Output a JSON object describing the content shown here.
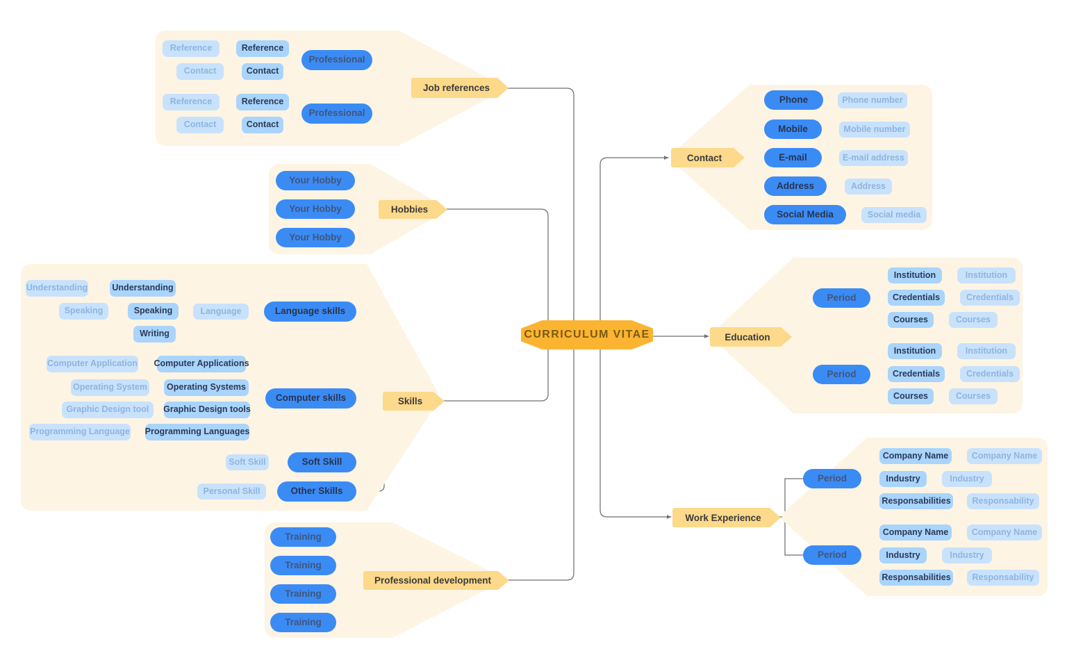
{
  "core": {
    "label": "CURRICULUM VITAE"
  },
  "palette": {
    "canvas": "#ffffff",
    "backdrop": "#fdf4e3",
    "core_fill": "#fbb431",
    "core_text": "#7a5a12",
    "chip_fill": "#fcd98b",
    "chip_text": "#3a3a3a",
    "blue": "#3b8bf5",
    "blue_text": "#41557a",
    "mid_blue": "#a9d4fb",
    "mid_blue_text": "#2c3a57",
    "pale_blue": "#c8e2fc",
    "pale_blue_text": "#8fb4de",
    "wire": "#6f6f6f"
  },
  "branches": {
    "job_references": {
      "chip": "Job references",
      "groups": [
        {
          "parent": "Professional",
          "rows": [
            {
              "mid": "Reference",
              "pale": "Reference"
            },
            {
              "mid": "Contact",
              "pale": "Contact"
            }
          ]
        },
        {
          "parent": "Professional",
          "rows": [
            {
              "mid": "Reference",
              "pale": "Reference"
            },
            {
              "mid": "Contact",
              "pale": "Contact"
            }
          ]
        }
      ]
    },
    "hobbies": {
      "chip": "Hobbies",
      "items": [
        "Your Hobby",
        "Your Hobby",
        "Your Hobby"
      ]
    },
    "skills": {
      "chip": "Skills",
      "groups": [
        {
          "parent": "Language skills",
          "hub": "Language",
          "rows": [
            {
              "mid": "Understanding",
              "pale": "Understanding"
            },
            {
              "mid": "Speaking",
              "pale": "Speaking"
            },
            {
              "mid": "Writing",
              "pale": ""
            }
          ]
        },
        {
          "parent": "Computer skills",
          "hub": "",
          "rows": [
            {
              "mid": "Computer Applications",
              "pale": "Computer Application"
            },
            {
              "mid": "Operating Systems",
              "pale": "Operating System"
            },
            {
              "mid": "Graphic Design tools",
              "pale": "Graphic Design tool"
            },
            {
              "mid": "Programming Languages",
              "pale": "Programming Language"
            }
          ]
        },
        {
          "parent": "Soft Skill",
          "hub": "",
          "rows": [
            {
              "mid": "",
              "pale": "Soft Skill"
            }
          ]
        },
        {
          "parent": "Other Skills",
          "hub": "",
          "rows": [
            {
              "mid": "",
              "pale": "Personal Skill"
            }
          ]
        }
      ]
    },
    "professional_development": {
      "chip": "Professional development",
      "items": [
        "Training",
        "Training",
        "Training",
        "Training"
      ]
    },
    "contact": {
      "chip": "Contact",
      "rows": [
        {
          "key": "Phone",
          "value": "Phone number"
        },
        {
          "key": "Mobile",
          "value": "Mobile number"
        },
        {
          "key": "E-mail",
          "value": "E-mail address"
        },
        {
          "key": "Address",
          "value": "Address"
        },
        {
          "key": "Social Media",
          "value": "Social media"
        }
      ]
    },
    "education": {
      "chip": "Education",
      "groups": [
        {
          "period": "Period",
          "rows": [
            {
              "mid": "Institution",
              "pale": "Institution"
            },
            {
              "mid": "Credentials",
              "pale": "Credentials"
            },
            {
              "mid": "Courses",
              "pale": "Courses"
            }
          ]
        },
        {
          "period": "Period",
          "rows": [
            {
              "mid": "Institution",
              "pale": "Institution"
            },
            {
              "mid": "Credentials",
              "pale": "Credentials"
            },
            {
              "mid": "Courses",
              "pale": "Courses"
            }
          ]
        }
      ]
    },
    "work_experience": {
      "chip": "Work Experience",
      "groups": [
        {
          "period": "Period",
          "rows": [
            {
              "mid": "Company Name",
              "pale": "Company Name"
            },
            {
              "mid": "Industry",
              "pale": "Industry"
            },
            {
              "mid": "Responsabilities",
              "pale": "Responsability"
            }
          ]
        },
        {
          "period": "Period",
          "rows": [
            {
              "mid": "Company Name",
              "pale": "Company Name"
            },
            {
              "mid": "Industry",
              "pale": "Industry"
            },
            {
              "mid": "Responsabilities",
              "pale": "Responsability"
            }
          ]
        }
      ]
    }
  }
}
